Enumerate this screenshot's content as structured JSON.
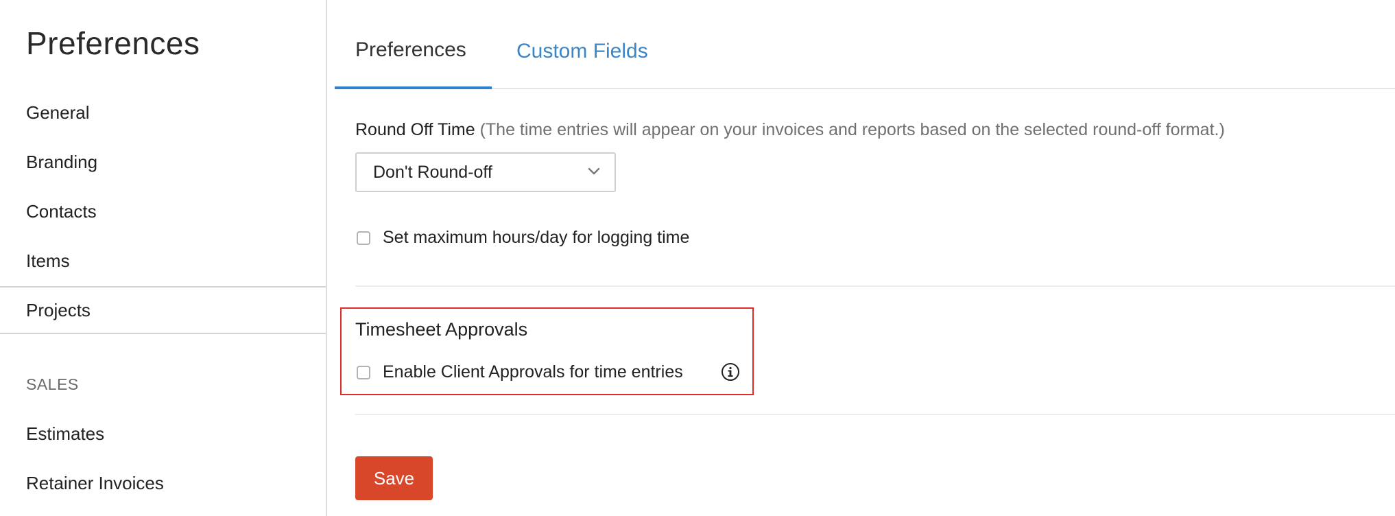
{
  "sidebar": {
    "title": "Preferences",
    "items": [
      {
        "label": "General"
      },
      {
        "label": "Branding"
      },
      {
        "label": "Contacts"
      },
      {
        "label": "Items"
      },
      {
        "label": "Projects",
        "active": true
      }
    ],
    "sales_section_label": "SALES",
    "sales_items": [
      {
        "label": "Estimates"
      },
      {
        "label": "Retainer Invoices"
      }
    ]
  },
  "tabs": [
    {
      "label": "Preferences",
      "active": true
    },
    {
      "label": "Custom Fields"
    }
  ],
  "round_off": {
    "label": "Round Off Time",
    "hint": "(The time entries will appear on your invoices and reports based on the selected round-off format.)",
    "selected": "Don't Round-off"
  },
  "max_hours": {
    "label": "Set maximum hours/day for logging time",
    "checked": false
  },
  "timesheet_approvals": {
    "title": "Timesheet Approvals",
    "client_approvals_label": "Enable Client Approvals for time entries",
    "checked": false,
    "info_icon": "info-icon"
  },
  "actions": {
    "save_label": "Save"
  },
  "colors": {
    "accent": "#2f7fd1",
    "link": "#3a86c8",
    "save": "#d9472b",
    "highlight": "#e02b2b"
  }
}
